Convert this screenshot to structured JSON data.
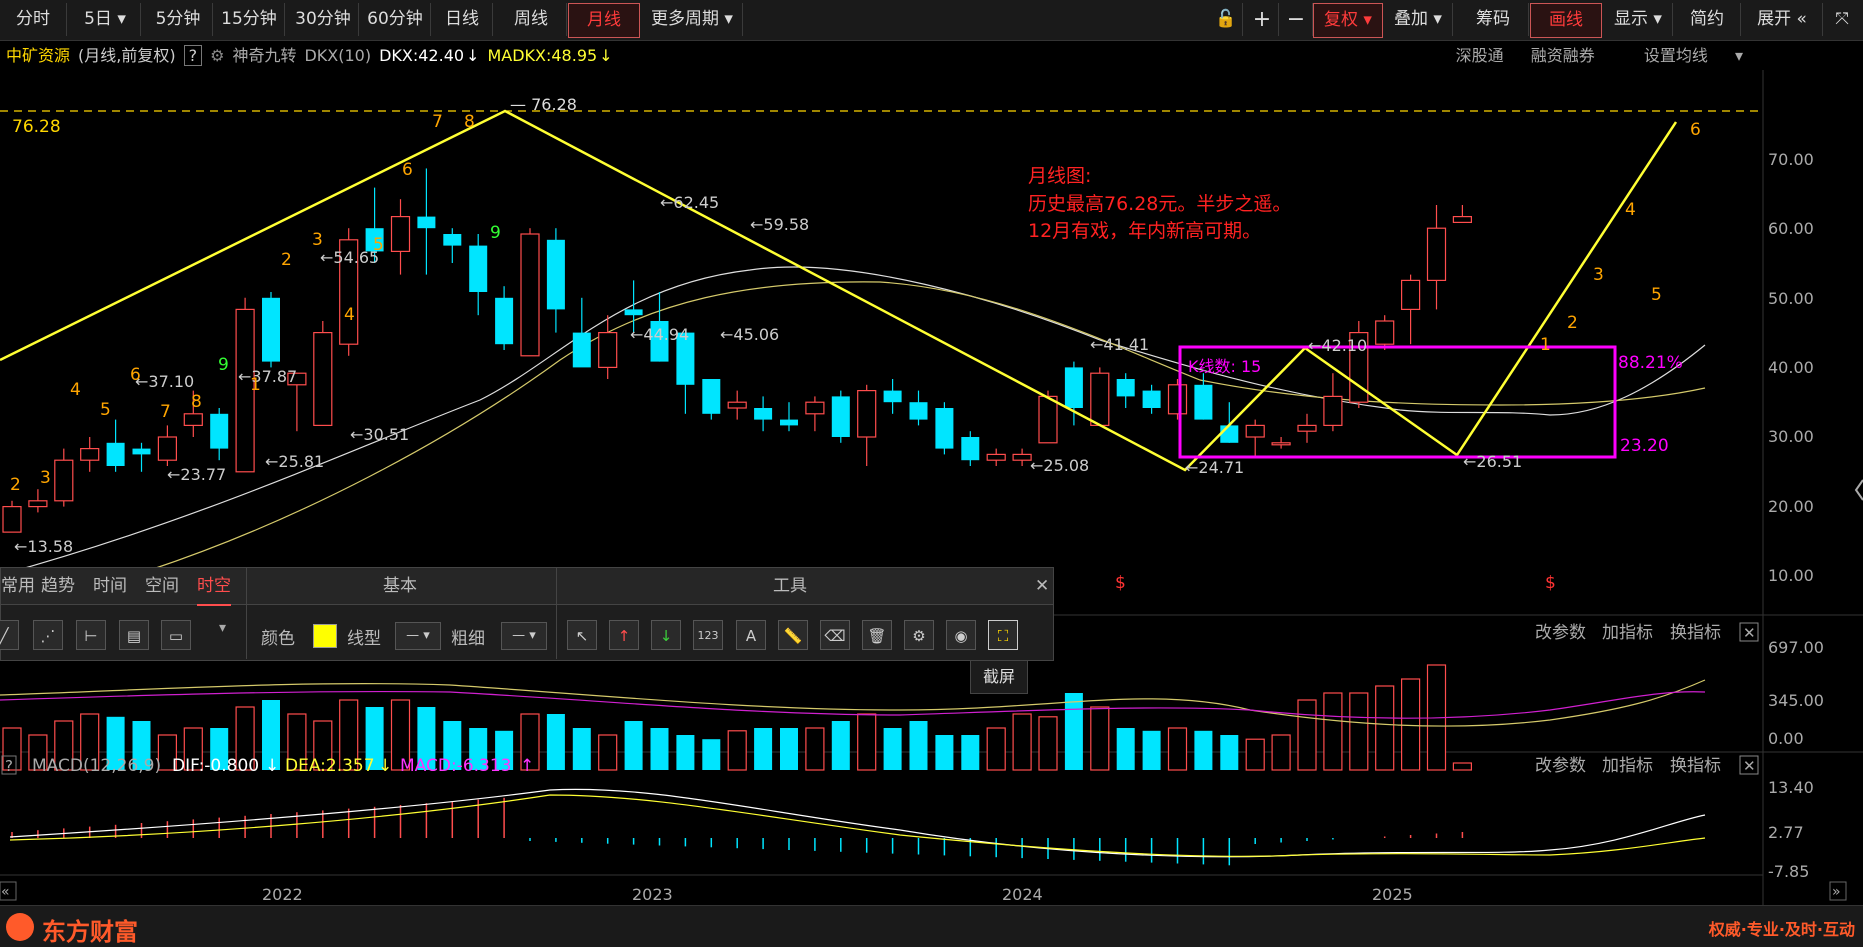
{
  "toolbar": {
    "periods": [
      "分时",
      "5日",
      "5分钟",
      "15分钟",
      "30分钟",
      "60分钟",
      "日线",
      "周线",
      "月线",
      "更多周期"
    ],
    "active_period": "月线",
    "right_buttons": [
      "复权",
      "叠加",
      "筹码",
      "画线",
      "显示",
      "简约",
      "展开"
    ]
  },
  "header": {
    "stock_name": "中矿资源",
    "stock_mode": "(月线,前复权)",
    "help": "?",
    "indicator_name": "神奇九转",
    "indicator_param": "DKX(10)",
    "dkx": "DKX:42.40",
    "madkx": "MADKX:48.95",
    "links": [
      "深股通",
      "融资融券",
      "设置均线"
    ]
  },
  "price_axis": [
    "70.00",
    "60.00",
    "50.00",
    "40.00",
    "30.00",
    "20.00",
    "10.00"
  ],
  "year_axis": [
    "2022",
    "2023",
    "2024",
    "2025"
  ],
  "annotation": {
    "line1": "月线图:",
    "line2": "历史最高76.28元。半步之遥。",
    "line3": "12月有戏，年内新高可期。"
  },
  "price_labels": {
    "high_line": "76.28",
    "peak": "76.28",
    "a": "←62.45",
    "b": "←59.58",
    "c": "←54.65",
    "d": "←44.94",
    "e": "←45.06",
    "f": "←41.41",
    "g": "←37.10",
    "h": "←37.87",
    "i": "←30.51",
    "j": "←25.81",
    "k": "←23.77",
    "l": "←25.08",
    "m": "←24.71",
    "n": "←13.58",
    "o": "←42.10",
    "p": "←26.51"
  },
  "box": {
    "kcount": "K线数: 15",
    "pct": "88.21%",
    "low": "23.20"
  },
  "nine_turn_labels": [
    "2",
    "3",
    "4",
    "5",
    "6",
    "7",
    "8",
    "1",
    "9",
    "2",
    "3",
    "4",
    "5",
    "6",
    "7",
    "8",
    "9",
    "1",
    "2",
    "3",
    "4",
    "5",
    "6"
  ],
  "panel": {
    "tabs": [
      "常用",
      "趋势",
      "时间",
      "空间",
      "时空"
    ],
    "active_tab": "时空",
    "section_basic": "基本",
    "section_tools": "工具",
    "color_label": "颜色",
    "linetype_label": "线型",
    "width_label": "粗细",
    "tool_123": "123",
    "tool_a": "A",
    "close": "✕",
    "tooltip": "截屏"
  },
  "volume": {
    "buttons": [
      "改参数",
      "加指标",
      "换指标"
    ],
    "axis": [
      "697.00",
      "345.00",
      "0.00"
    ]
  },
  "macd": {
    "help": "?",
    "name": "MACD(12,26,9)",
    "dif": "DIF:-0.800",
    "dea": "DEA:2.357",
    "macd": "MACD:-6.313",
    "buttons": [
      "改参数",
      "加指标",
      "换指标"
    ],
    "axis": [
      "13.40",
      "2.77",
      "-7.85"
    ]
  },
  "footer": {
    "brand": "东方财富",
    "slogan": "权威·专业·及时·互动"
  },
  "colors": {
    "up": "#ff4d4d",
    "down": "#00e5ff",
    "trend_line": "#ffff33",
    "box": "#ff00ff",
    "annotation": "#ff2222",
    "label_orange": "#ffa500"
  }
}
